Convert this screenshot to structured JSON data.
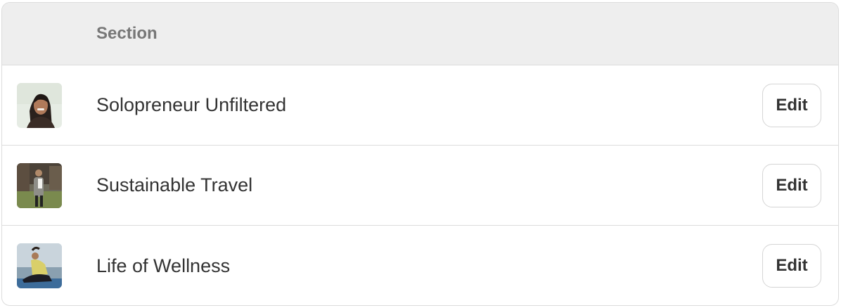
{
  "header": {
    "section_label": "Section"
  },
  "rows": [
    {
      "label": "Solopreneur Unfiltered",
      "edit_label": "Edit",
      "thumbnail": "portrait-woman-smiling"
    },
    {
      "label": "Sustainable Travel",
      "edit_label": "Edit",
      "thumbnail": "person-standing-outdoors"
    },
    {
      "label": "Life of Wellness",
      "edit_label": "Edit",
      "thumbnail": "person-yoga-pose-by-water"
    }
  ]
}
